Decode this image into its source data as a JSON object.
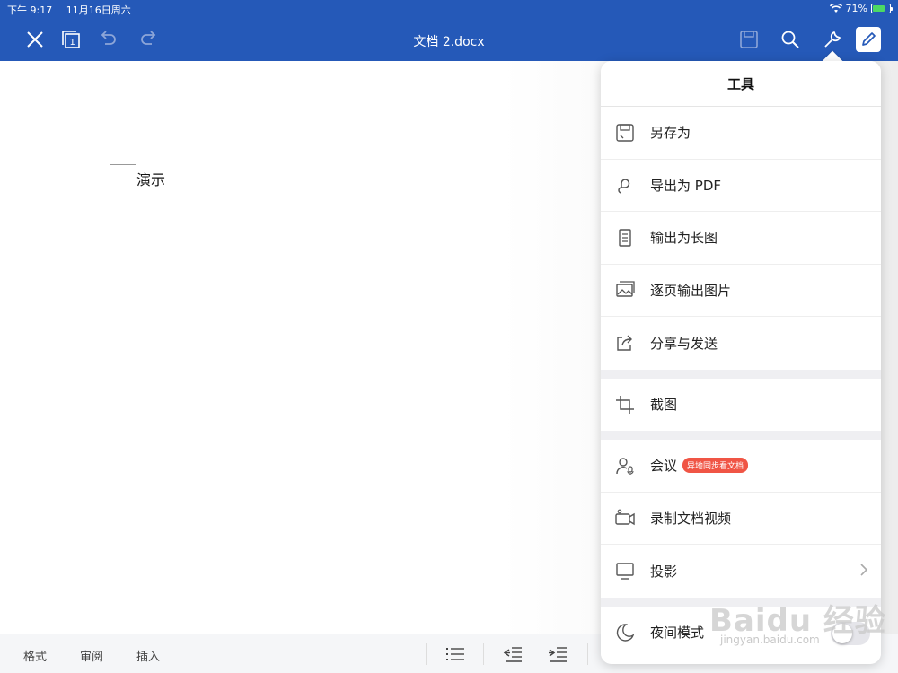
{
  "status_bar": {
    "time": "下午 9:17",
    "date": "11月16日周六",
    "battery": "71%",
    "battery_level": 0.71
  },
  "header": {
    "doc_title": "文档 2.docx"
  },
  "document": {
    "text": "演示"
  },
  "bottom_toolbar": {
    "tabs": [
      "格式",
      "审阅",
      "插入"
    ]
  },
  "tools_panel": {
    "title": "工具",
    "items": [
      {
        "label": "另存为",
        "icon": "save-as-icon"
      },
      {
        "label": "导出为 PDF",
        "icon": "export-pdf-icon"
      },
      {
        "label": "输出为长图",
        "icon": "long-image-icon"
      },
      {
        "label": "逐页输出图片",
        "icon": "page-images-icon"
      },
      {
        "label": "分享与发送",
        "icon": "share-icon"
      },
      {
        "label": "截图",
        "icon": "crop-icon"
      },
      {
        "label": "会议",
        "icon": "meeting-icon",
        "badge": "异地同步看文档"
      },
      {
        "label": "录制文档视频",
        "icon": "video-record-icon"
      },
      {
        "label": "投影",
        "icon": "projection-icon"
      },
      {
        "label": "夜间模式",
        "icon": "moon-icon"
      }
    ]
  },
  "watermark": {
    "text": "Baidu 经验",
    "sub": "jingyan.baidu.com"
  },
  "colors": {
    "header_bg": "#2559b8",
    "badge": "#f05545"
  }
}
